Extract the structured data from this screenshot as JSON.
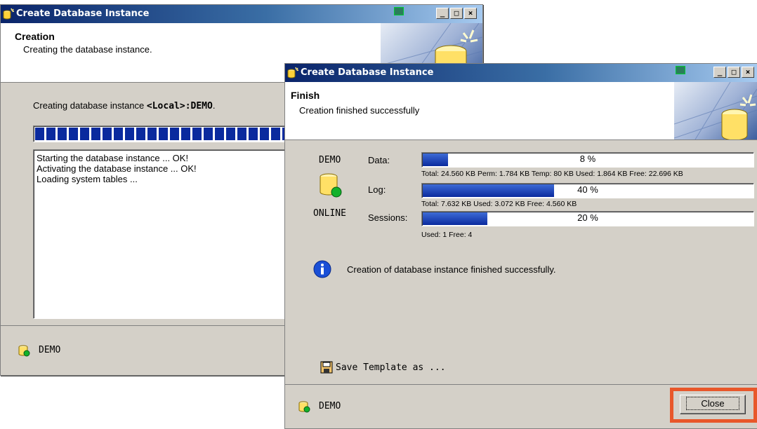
{
  "back_window": {
    "title": "Create Database Instance",
    "header_title": "Creation",
    "header_subtitle": "Creating the database instance.",
    "status_prefix": "Creating database instance ",
    "status_local": "<Local>",
    "status_name": ":DEMO",
    "status_suffix": ".",
    "log_lines": [
      "Starting the database instance ... OK!",
      "Activating the database instance ... OK!",
      "Loading system tables ..."
    ],
    "footer_instance": "DEMO"
  },
  "front_window": {
    "title": "Create Database Instance",
    "header_title": "Finish",
    "header_subtitle": "Creation finished successfully",
    "instance_name": "DEMO",
    "instance_state": "ONLINE",
    "data": {
      "label": "Data:",
      "percent": 8,
      "percent_text": "8 %",
      "details": "Total: 24.560 KB Perm: 1.784 KB Temp: 80 KB Used: 1.864 KB Free: 22.696 KB"
    },
    "log": {
      "label": "Log:",
      "percent": 40,
      "percent_text": "40 %",
      "details": "Total: 7.632 KB Used: 3.072 KB Free: 4.560 KB"
    },
    "sessions": {
      "label": "Sessions:",
      "percent": 20,
      "percent_text": "20 %",
      "details": "Used: 1 Free: 4"
    },
    "info_message": "Creation of database instance finished successfully.",
    "save_template_label": "Save Template as ...",
    "footer_instance": "DEMO",
    "close_label": "Close"
  },
  "colors": {
    "highlight": "#e8572a",
    "progress_blue": "#0a2a9e"
  }
}
